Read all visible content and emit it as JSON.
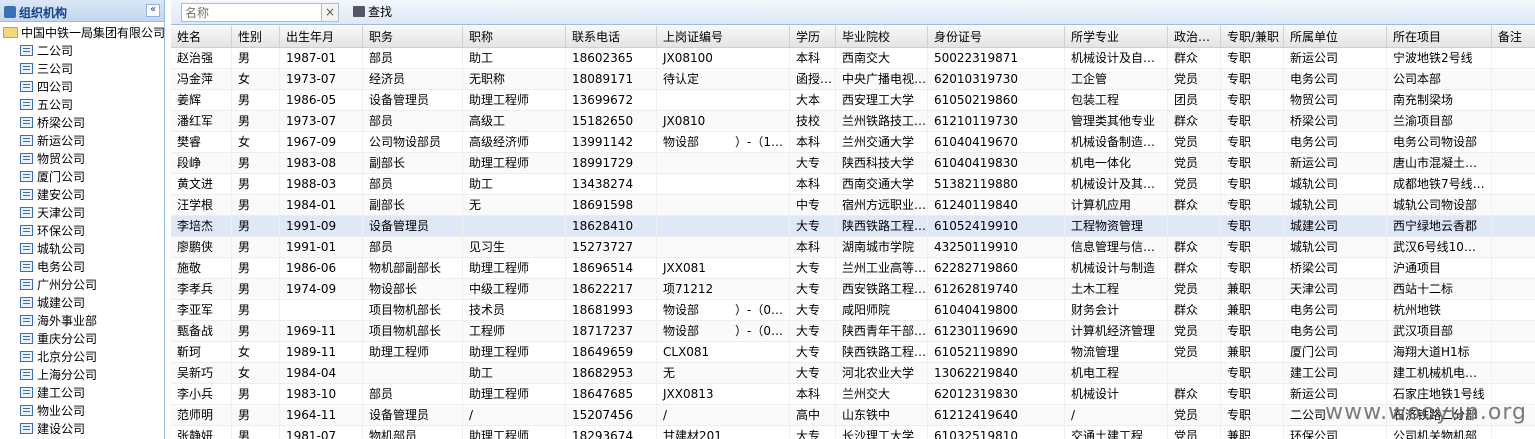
{
  "sidebar": {
    "title": "组织机构",
    "collapse_glyph": "«",
    "root": "中国中铁一局集团有限公司",
    "items": [
      "二公司",
      "三公司",
      "四公司",
      "五公司",
      "桥梁公司",
      "新运公司",
      "物贸公司",
      "厦门公司",
      "建安公司",
      "天津公司",
      "环保公司",
      "城轨公司",
      "电务公司",
      "广州分公司",
      "城建公司",
      "海外事业部",
      "重庆分公司",
      "北京分公司",
      "上海分公司",
      "建工公司",
      "物业公司",
      "建设公司"
    ]
  },
  "toolbar": {
    "search_placeholder": "名称",
    "clear_glyph": "×",
    "find_label": "查找"
  },
  "table": {
    "columns": [
      "姓名",
      "性别",
      "出生年月",
      "职务",
      "职称",
      "联系电话",
      "上岗证编号",
      "学历",
      "毕业院校",
      "身份证号",
      "所学专业",
      "政治…",
      "专职/兼职",
      "所属单位",
      "所在项目",
      "备注"
    ],
    "rows": [
      [
        "赵治强",
        "男",
        "1987-01",
        "部员",
        "助工",
        "18602365",
        "JX08100",
        "本科",
        "西南交大",
        "50022319871",
        "机械设计及自…",
        "群众",
        "专职",
        "新运公司",
        "宁波地铁2号线",
        ""
      ],
      [
        "冯金萍",
        "女",
        "1973-07",
        "经济员",
        "无职称",
        "18089171",
        "待认定",
        "函授…",
        "中央广播电视…",
        "62010319730",
        "工企管",
        "党员",
        "专职",
        "电务公司",
        "公司本部",
        ""
      ],
      [
        "姜辉",
        "男",
        "1986-05",
        "设备管理员",
        "助理工程师",
        "13699672",
        "",
        "大本",
        "西安理工大学",
        "61050219860",
        "包装工程",
        "团员",
        "专职",
        "物贸公司",
        "南充制梁场",
        ""
      ],
      [
        "潘红军",
        "男",
        "1973-07",
        "部员",
        "高级工",
        "15182650",
        "JX0810",
        "技校",
        "兰州铁路技工…",
        "61210119730",
        "管理类其他专业",
        "群众",
        "专职",
        "桥梁公司",
        "兰渝项目部",
        ""
      ],
      [
        "樊睿",
        "女",
        "1967-09",
        "公司物设部员",
        "高级经济师",
        "13991142",
        "物设部　　　）-（1…",
        "本科",
        "兰州交通大学",
        "61040419670",
        "机械设备制造…",
        "党员",
        "专职",
        "电务公司",
        "电务公司物设部",
        ""
      ],
      [
        "段峥",
        "男",
        "1983-08",
        "副部长",
        "助理工程师",
        "18991729",
        "",
        "大专",
        "陕西科技大学",
        "61040419830",
        "机电一体化",
        "党员",
        "专职",
        "新运公司",
        "唐山市混凝土…",
        ""
      ],
      [
        "黄文进",
        "男",
        "1988-03",
        "部员",
        "助工",
        "13438274",
        "",
        "本科",
        "西南交通大学",
        "51382119880",
        "机械设计及其…",
        "党员",
        "专职",
        "城轨公司",
        "成都地铁7号线…",
        ""
      ],
      [
        "汪学根",
        "男",
        "1984-01",
        "副部长",
        "无",
        "18691598",
        "",
        "中专",
        "宿州方远职业…",
        "61240119840",
        "计算机应用",
        "群众",
        "专职",
        "城轨公司",
        "城轨公司物设部",
        ""
      ],
      [
        "李培杰",
        "男",
        "1991-09",
        "设备管理员",
        "",
        "18628410",
        "",
        "大专",
        "陕西铁路工程…",
        "61052419910",
        "工程物资管理",
        "",
        "专职",
        "城建公司",
        "西宁绿地云香郡",
        ""
      ],
      [
        "廖鹏侠",
        "男",
        "1991-01",
        "部员",
        "见习生",
        "15273727",
        "",
        "本科",
        "湖南城市学院",
        "43250119910",
        "信息管理与信…",
        "群众",
        "专职",
        "城轨公司",
        "武汉6号线10…",
        ""
      ],
      [
        "施敬",
        "男",
        "1986-06",
        "物机部副部长",
        "助理工程师",
        "18696514",
        "JXX081",
        "大专",
        "兰州工业高等…",
        "62282719860",
        "机械设计与制造",
        "群众",
        "专职",
        "桥梁公司",
        "沪通项目",
        ""
      ],
      [
        "李孝兵",
        "男",
        "1974-09",
        "物设部长",
        "中级工程师",
        "18622217",
        "项71212",
        "大专",
        "西安铁路工程…",
        "61262819740",
        "土木工程",
        "党员",
        "兼职",
        "天津公司",
        "西站十二标",
        ""
      ],
      [
        "李亚军",
        "男",
        "",
        "项目物机部长",
        "技术员",
        "18681993",
        "物设部　　　）-（0…",
        "大专",
        "咸阳师院",
        "61040419800",
        "财务会计",
        "群众",
        "兼职",
        "电务公司",
        "杭州地铁",
        ""
      ],
      [
        "甄备战",
        "男",
        "1969-11",
        "项目物机部长",
        "工程师",
        "18717237",
        "物设部　　　）-（0…",
        "大专",
        "陕西青年干部…",
        "61230119690",
        "计算机经济管理",
        "党员",
        "专职",
        "电务公司",
        "武汉项目部",
        ""
      ],
      [
        "靳珂",
        "女",
        "1989-11",
        "助理工程师",
        "助理工程师",
        "18649659",
        "CLX081",
        "大专",
        "陕西铁路工程…",
        "61052119890",
        "物流管理",
        "党员",
        "兼职",
        "厦门公司",
        "海翔大道H1标",
        ""
      ],
      [
        "吴新巧",
        "女",
        "1984-04",
        "",
        "助工",
        "18682953",
        "无",
        "大专",
        "河北农业大学",
        "13062219840",
        "机电工程",
        "",
        "专职",
        "建工公司",
        "建工机械机电…",
        ""
      ],
      [
        "李小兵",
        "男",
        "1983-10",
        "部员",
        "助理工程师",
        "18647685",
        "JXX0813",
        "本科",
        "兰州交大",
        "62012319830",
        "机械设计",
        "群众",
        "专职",
        "新运公司",
        "石家庄地铁1号线",
        ""
      ],
      [
        "范师明",
        "男",
        "1964-11",
        "设备管理员",
        "/",
        "15207456",
        "/",
        "高中",
        "山东铁中",
        "61212419640",
        "/",
        "党员",
        "专职",
        "二公司",
        "石济铁路二分部",
        ""
      ],
      [
        "张静妍",
        "男",
        "1981-07",
        "物机部员",
        "助理工程师",
        "18293674",
        "甘建材201",
        "大专",
        "长沙理工大学",
        "61032519810",
        "交通土建工程",
        "党员",
        "兼职",
        "环保公司",
        "公司机关物机部",
        ""
      ]
    ]
  },
  "watermark": "www.wooyun.org"
}
